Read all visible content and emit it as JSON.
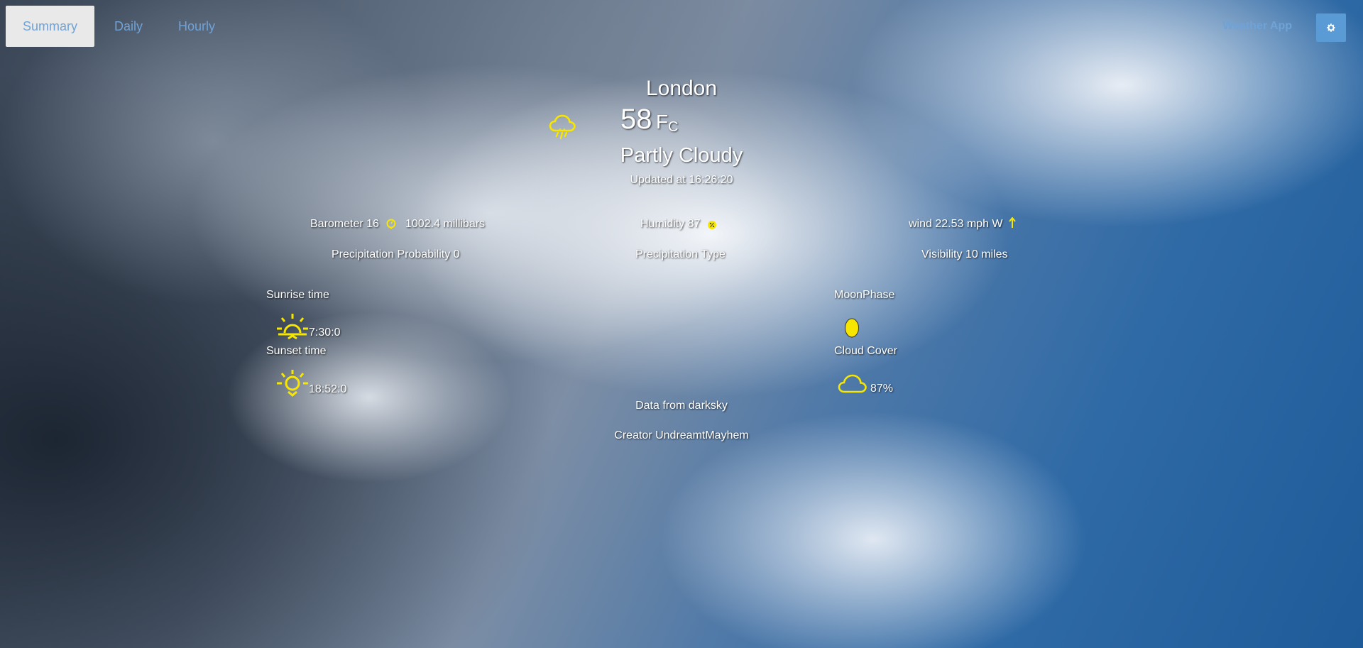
{
  "nav": {
    "tabs": [
      {
        "label": "Summary",
        "active": true
      },
      {
        "label": "Daily",
        "active": false
      },
      {
        "label": "Hourly",
        "active": false
      }
    ],
    "brand": "Weather App",
    "settings_icon": "gear-icon"
  },
  "current": {
    "city": "London",
    "temperature": "58",
    "unit_f": "F",
    "unit_c": "C",
    "summary": "Partly Cloudy",
    "updated": "Updated at 16:26:20",
    "icon": "rain-cloud-icon"
  },
  "stats": {
    "barometer_label": "Barometer 16",
    "barometer_value": "1002.4 millibars",
    "humidity_label": "Humidity 87",
    "wind": "wind 22.53 mph W",
    "precip_prob": "Precipitation Probability  0",
    "precip_type": "Precipitation Type",
    "visibility": "Visibility  10 miles"
  },
  "sun": {
    "sunrise_label": "Sunrise time",
    "sunrise_value": "7:30:0",
    "sunset_label": "Sunset time",
    "sunset_value": "18:52:0"
  },
  "sky": {
    "moon_label": "MoonPhase",
    "cloud_label": "Cloud Cover",
    "cloud_value": "87%"
  },
  "footer": {
    "source": "Data from darksky",
    "creator": "Creator UndreamtMayhem"
  },
  "colors": {
    "accent": "#6fa3d8",
    "icon_yellow": "#f7e600"
  }
}
